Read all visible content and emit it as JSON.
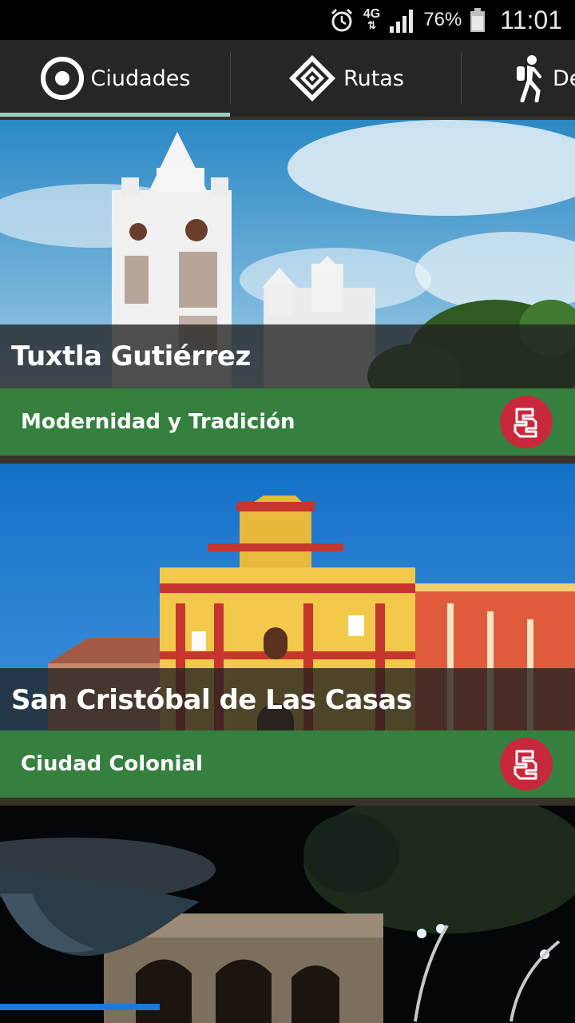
{
  "status_bar": {
    "network": "4G",
    "battery_percent": "76%",
    "time": "11:01",
    "icons": [
      "alarm-icon",
      "data-arrows-icon",
      "signal-icon",
      "battery-icon"
    ]
  },
  "tabs": [
    {
      "label": "Ciudades",
      "icon": "target-icon",
      "selected": true
    },
    {
      "label": "Rutas",
      "icon": "diamond-pattern-icon",
      "selected": false
    },
    {
      "label": "De",
      "icon": "hiker-icon",
      "selected": false
    }
  ],
  "cards": [
    {
      "title": "Tuxtla Gutiérrez",
      "subtitle": "Modernidad y Tradición",
      "badge_icon": "fret-pattern-icon",
      "photo": "white-church-photo"
    },
    {
      "title": "San Cristóbal de Las Casas",
      "subtitle": "Ciudad Colonial",
      "badge_icon": "fret-pattern-icon",
      "photo": "yellow-cathedral-photo"
    },
    {
      "title": "",
      "subtitle": "",
      "photo": "night-arcade-photo"
    }
  ],
  "colors": {
    "tab_indicator": "#9ccfc3",
    "subtitle_band": "#35803f",
    "badge": "#c8283c"
  }
}
